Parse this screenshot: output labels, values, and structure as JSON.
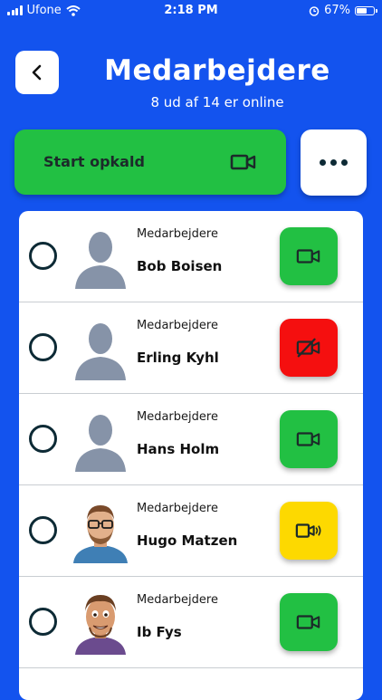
{
  "status_bar": {
    "carrier": "Ufone",
    "time": "2:18 PM",
    "battery_level": "67%",
    "battery_fraction": 0.67
  },
  "header": {
    "back_icon": "chevron-left-icon",
    "title": "Medarbejdere",
    "subtitle": "8 ud af 14 er online"
  },
  "actions": {
    "start_call_label": "Start opkald",
    "start_call_icon": "video-camera-icon",
    "more_icon": "more-dots-icon"
  },
  "colors": {
    "background": "#1353ee",
    "green": "#22c043",
    "red": "#f50f0f",
    "yellow": "#fdd900",
    "dark": "#0d2a35"
  },
  "members": [
    {
      "role": "Medarbejdere",
      "name": "Bob Boisen",
      "status": "available",
      "avatar": "placeholder"
    },
    {
      "role": "Medarbejdere",
      "name": "Erling Kyhl",
      "status": "unavailable",
      "avatar": "placeholder"
    },
    {
      "role": "Medarbejdere",
      "name": "Hans Holm",
      "status": "available",
      "avatar": "placeholder"
    },
    {
      "role": "Medarbejdere",
      "name": "Hugo Matzen",
      "status": "in-call",
      "avatar": "photo"
    },
    {
      "role": "Medarbejdere",
      "name": "Ib Fys",
      "status": "available",
      "avatar": "photo-cartoon"
    }
  ]
}
